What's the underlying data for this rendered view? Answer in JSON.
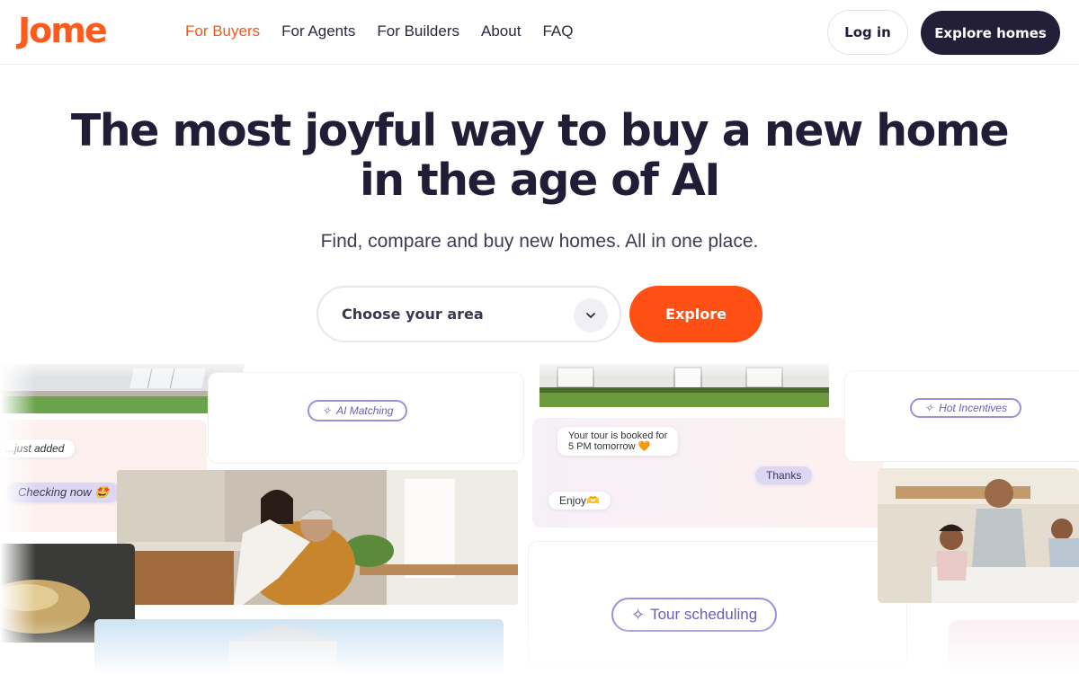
{
  "brand": {
    "logo_text": "Jome",
    "accent_color": "#fe5a1d",
    "dark_color": "#231f38"
  },
  "nav": {
    "items": [
      {
        "label": "For Buyers",
        "active": true
      },
      {
        "label": "For Agents",
        "active": false
      },
      {
        "label": "For Builders",
        "active": false
      },
      {
        "label": "About",
        "active": false
      },
      {
        "label": "FAQ",
        "active": false
      }
    ]
  },
  "header": {
    "login_label": "Log in",
    "explore_homes_label": "Explore homes"
  },
  "hero": {
    "title_line1": "The most joyful way to buy a new home",
    "title_line2": "in the age of AI",
    "subtitle": "Find, compare and buy new homes. All in one place.",
    "area_select": {
      "value": "Choose your area",
      "icon": "chevron-down-icon"
    },
    "explore_label": "Explore"
  },
  "collage": {
    "ai_matching": "AI Matching",
    "hot_incentives": "Hot Incentives",
    "tour_scheduling": "Tour scheduling",
    "sparkle_icon": "sparkle-icon",
    "chat_left": {
      "msg1": "...just added",
      "msg2": "Checking now 🤩"
    },
    "chat_center": {
      "msg1_line1": "Your tour is booked for",
      "msg1_line2": "5 PM tomorrow 🧡",
      "msg2": "Thanks",
      "msg3": "Enjoy🫶"
    }
  }
}
